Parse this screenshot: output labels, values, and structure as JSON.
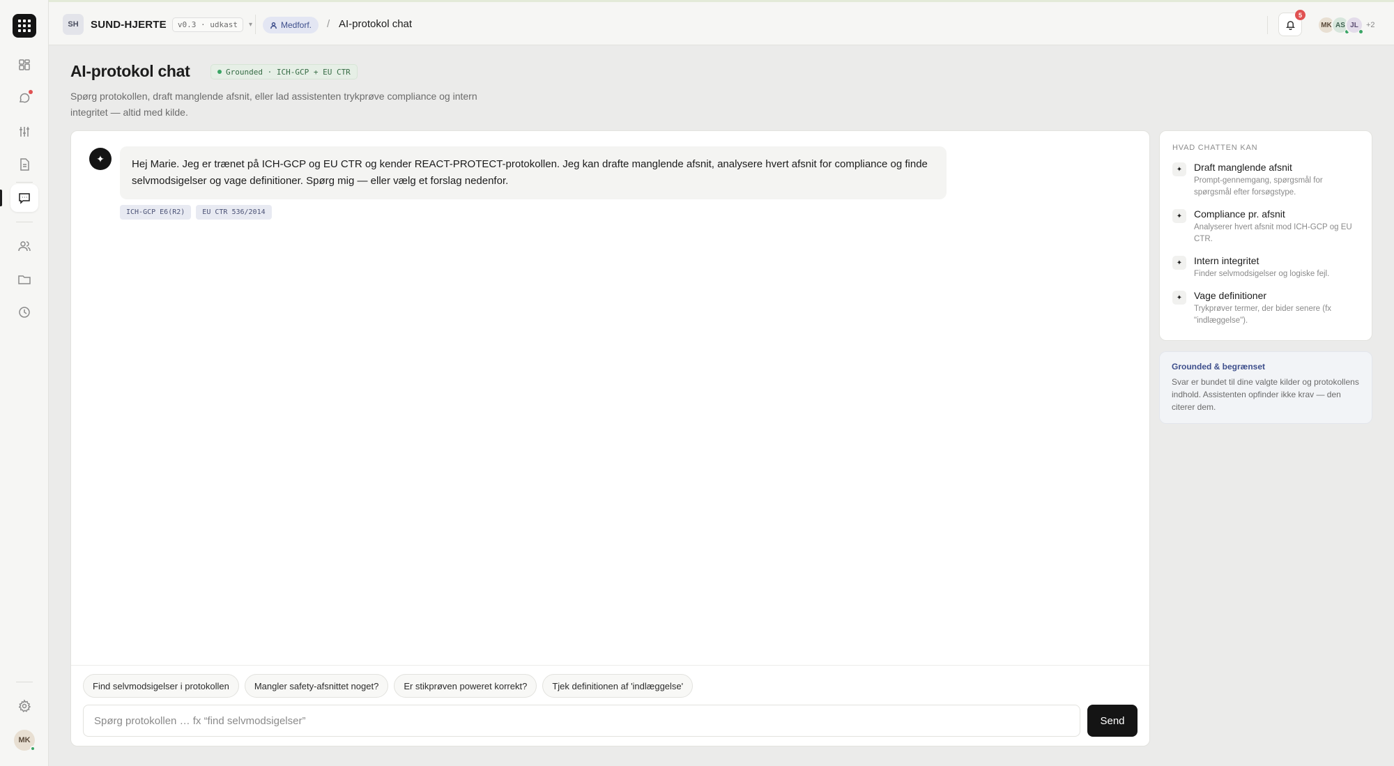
{
  "app": {
    "project_badge": "SH",
    "project_name": "SUND-HJERTE",
    "version": "v0.3 · udkast",
    "role": "Medforf.",
    "breadcrumb_title": "AI-protokol chat",
    "notification_count": "5",
    "collaborators": [
      {
        "initials": "MK",
        "color": "#e8dfd2"
      },
      {
        "initials": "AS",
        "color": "#d7e6dc"
      },
      {
        "initials": "JL",
        "color": "#e3dcea"
      }
    ],
    "collaborators_more": "+2",
    "user_initials": "MK"
  },
  "sidebar": {
    "items": [
      {
        "name": "dashboard-icon"
      },
      {
        "name": "chat-bubble-icon"
      },
      {
        "name": "sliders-icon"
      },
      {
        "name": "document-icon"
      },
      {
        "name": "ai-chat-icon"
      },
      {
        "name": "users-icon"
      },
      {
        "name": "folder-icon"
      },
      {
        "name": "clock-icon"
      }
    ],
    "active": "ai-chat-icon"
  },
  "header": {
    "title": "AI-protokol chat",
    "badge": "Grounded · ICH-GCP + EU CTR",
    "subtitle": "Spørg protokollen, draft manglende afsnit, eller lad assistenten trykprøve compliance og intern integritet — altid med kilde."
  },
  "chat": {
    "messages": [
      {
        "role": "assistant",
        "text": "Hej Marie. Jeg er trænet på ICH-GCP og EU CTR og kender REACT-PROTECT-protokollen. Jeg kan drafte manglende afsnit, analysere hvert afsnit for compliance og finde selvmodsigelser og vage definitioner. Spørg mig — eller vælg et forslag nedenfor.",
        "sources": [
          "ICH-GCP E6(R2)",
          "EU CTR 536/2014"
        ]
      }
    ],
    "suggestions": [
      "Find selvmodsigelser i protokollen",
      "Mangler safety-afsnittet noget?",
      "Er stikprøven poweret korrekt?",
      "Tjek definitionen af 'indlæggelse'"
    ],
    "input_value": "",
    "input_placeholder": "Spørg protokollen … fx “find selvmodsigelser”",
    "send_label": "Send"
  },
  "capabilities": {
    "title": "HVAD CHATTEN KAN",
    "items": [
      {
        "title": "Draft manglende afsnit",
        "desc": "Prompt-gennemgang, spørgsmål for spørgsmål efter forsøgstype."
      },
      {
        "title": "Compliance pr. afsnit",
        "desc": "Analyserer hvert afsnit mod ICH-GCP og EU CTR."
      },
      {
        "title": "Intern integritet",
        "desc": "Finder selvmodsigelser og logiske fejl."
      },
      {
        "title": "Vage definitioner",
        "desc": "Trykprøver termer, der bider senere (fx \"indlæggelse\")."
      }
    ]
  },
  "note": {
    "title": "Grounded & begrænset",
    "text": "Svar er bundet til dine valgte kilder og protokollens indhold. Assistenten opfinder ikke krav — den citerer dem."
  },
  "colors": {
    "accent": "#141414",
    "grounded_green": "#3aa565",
    "alert_red": "#e05252",
    "role_blue": "#3e4f8c"
  }
}
